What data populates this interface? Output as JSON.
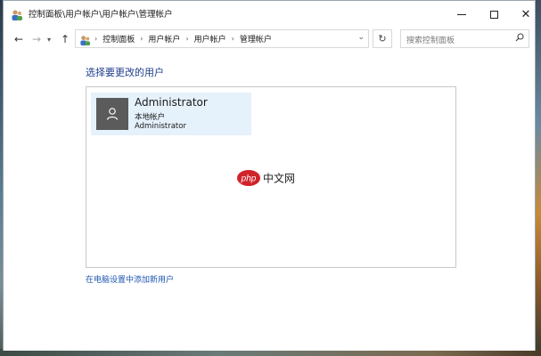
{
  "window": {
    "title": "控制面板\\用户帐户\\用户帐户\\管理帐户"
  },
  "address_bar": {
    "breadcrumbs": [
      "控制面板",
      "用户帐户",
      "用户帐户",
      "管理帐户"
    ],
    "search_placeholder": "搜索控制面板"
  },
  "main": {
    "heading": "选择要更改的用户",
    "users": [
      {
        "name": "Administrator",
        "type": "本地帐户",
        "group": "Administrator"
      }
    ],
    "add_user_link": "在电脑设置中添加新用户",
    "watermark": {
      "brand": "php",
      "text": "中文网"
    }
  },
  "colors": {
    "heading": "#1e3c8c",
    "link": "#1e56b0",
    "tile_bg": "#e5f1fb",
    "avatar_bg": "#5b5b5b",
    "watermark_red": "#d1232a"
  }
}
